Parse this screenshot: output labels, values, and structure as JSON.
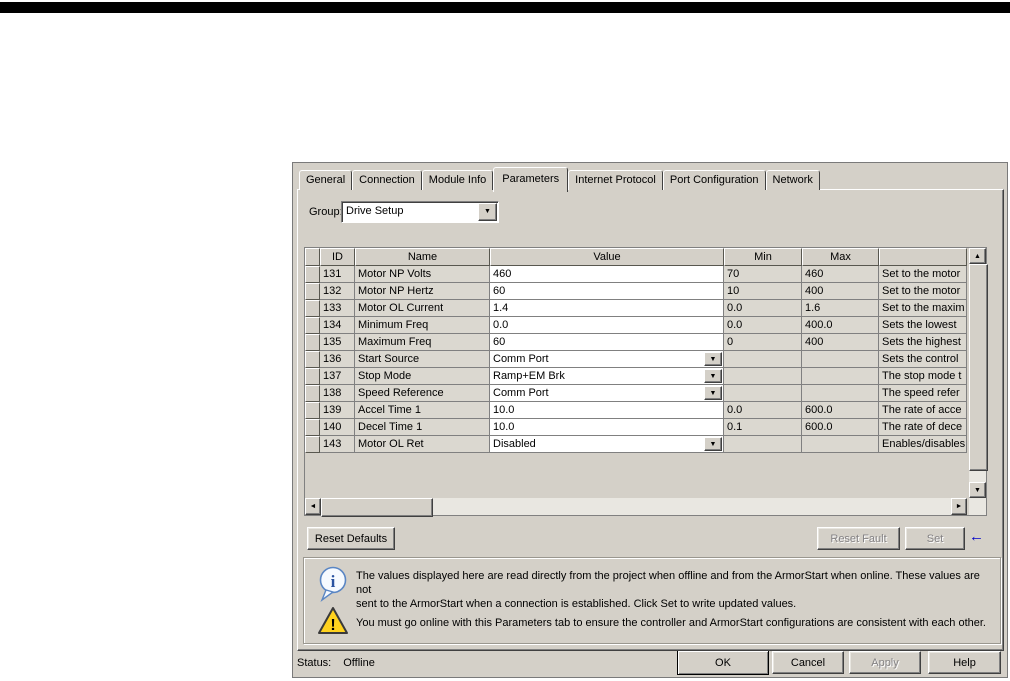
{
  "dialog": {
    "tabs": [
      {
        "label": "General",
        "active": false
      },
      {
        "label": "Connection",
        "active": false
      },
      {
        "label": "Module Info",
        "active": false
      },
      {
        "label": "Parameters",
        "active": true
      },
      {
        "label": "Internet Protocol",
        "active": false
      },
      {
        "label": "Port Configuration",
        "active": false
      },
      {
        "label": "Network",
        "active": false
      }
    ],
    "group": {
      "label": "Group:",
      "value": "Drive Setup"
    },
    "grid": {
      "columns": [
        "",
        "ID",
        "Name",
        "Value",
        "Min",
        "Max",
        ""
      ],
      "rows": [
        {
          "id": "131",
          "name": "Motor NP Volts",
          "value": "460",
          "combo": false,
          "min": "70",
          "max": "460",
          "desc": "Set to the motor"
        },
        {
          "id": "132",
          "name": "Motor NP Hertz",
          "value": "60",
          "combo": false,
          "min": "10",
          "max": "400",
          "desc": "Set to the motor"
        },
        {
          "id": "133",
          "name": "Motor OL Current",
          "value": "1.4",
          "combo": false,
          "min": "0.0",
          "max": "1.6",
          "desc": "Set to the maxim"
        },
        {
          "id": "134",
          "name": "Minimum Freq",
          "value": "0.0",
          "combo": false,
          "min": "0.0",
          "max": "400.0",
          "desc": "Sets the lowest"
        },
        {
          "id": "135",
          "name": "Maximum Freq",
          "value": "60",
          "combo": false,
          "min": "0",
          "max": "400",
          "desc": "Sets the highest"
        },
        {
          "id": "136",
          "name": "Start Source",
          "value": "Comm Port",
          "combo": true,
          "min": "",
          "max": "",
          "desc": "Sets the control"
        },
        {
          "id": "137",
          "name": "Stop Mode",
          "value": "Ramp+EM Brk",
          "combo": true,
          "min": "",
          "max": "",
          "desc": "The stop mode t"
        },
        {
          "id": "138",
          "name": "Speed Reference",
          "value": "Comm Port",
          "combo": true,
          "min": "",
          "max": "",
          "desc": "The speed refer"
        },
        {
          "id": "139",
          "name": "Accel Time 1",
          "value": "10.0",
          "combo": false,
          "min": "0.0",
          "max": "600.0",
          "desc": "The rate of acce"
        },
        {
          "id": "140",
          "name": "Decel Time 1",
          "value": "10.0",
          "combo": false,
          "min": "0.1",
          "max": "600.0",
          "desc": "The rate of dece"
        },
        {
          "id": "143",
          "name": "Motor OL Ret",
          "value": "Disabled",
          "combo": true,
          "min": "",
          "max": "",
          "desc": "Enables/disables"
        }
      ]
    },
    "buttons": {
      "reset_defaults": "Reset Defaults",
      "reset_fault": "Reset Fault",
      "set": "Set"
    },
    "notes": {
      "info_line1": "The values displayed here are read directly from the project when offline and from the ArmorStart when online. These values are not",
      "info_line2": "sent to the ArmorStart when a connection is established.  Click Set to write updated values.",
      "warning": "You must go online with this Parameters tab to ensure the controller and ArmorStart configurations are consistent with each other."
    },
    "status": {
      "label": "Status:",
      "value": "Offline"
    },
    "footer": {
      "ok": "OK",
      "cancel": "Cancel",
      "apply": "Apply",
      "help": "Help"
    }
  },
  "icons": {
    "dropdown": "▼",
    "scroll_up": "▲",
    "scroll_down": "▼",
    "scroll_left": "◄",
    "scroll_right": "►",
    "annotation_arrow": "←",
    "info_glyph": "i",
    "warning_glyph": "!"
  },
  "colors": {
    "dialog_bg": "#d4d0c8",
    "readonly_cell": "#dbd8d0",
    "grid_line": "#808080",
    "annotation_blue": "#0000c8",
    "warning_yellow": "#ffd21e",
    "info_blue": "#2a52a0",
    "top_bar": "#000000"
  }
}
